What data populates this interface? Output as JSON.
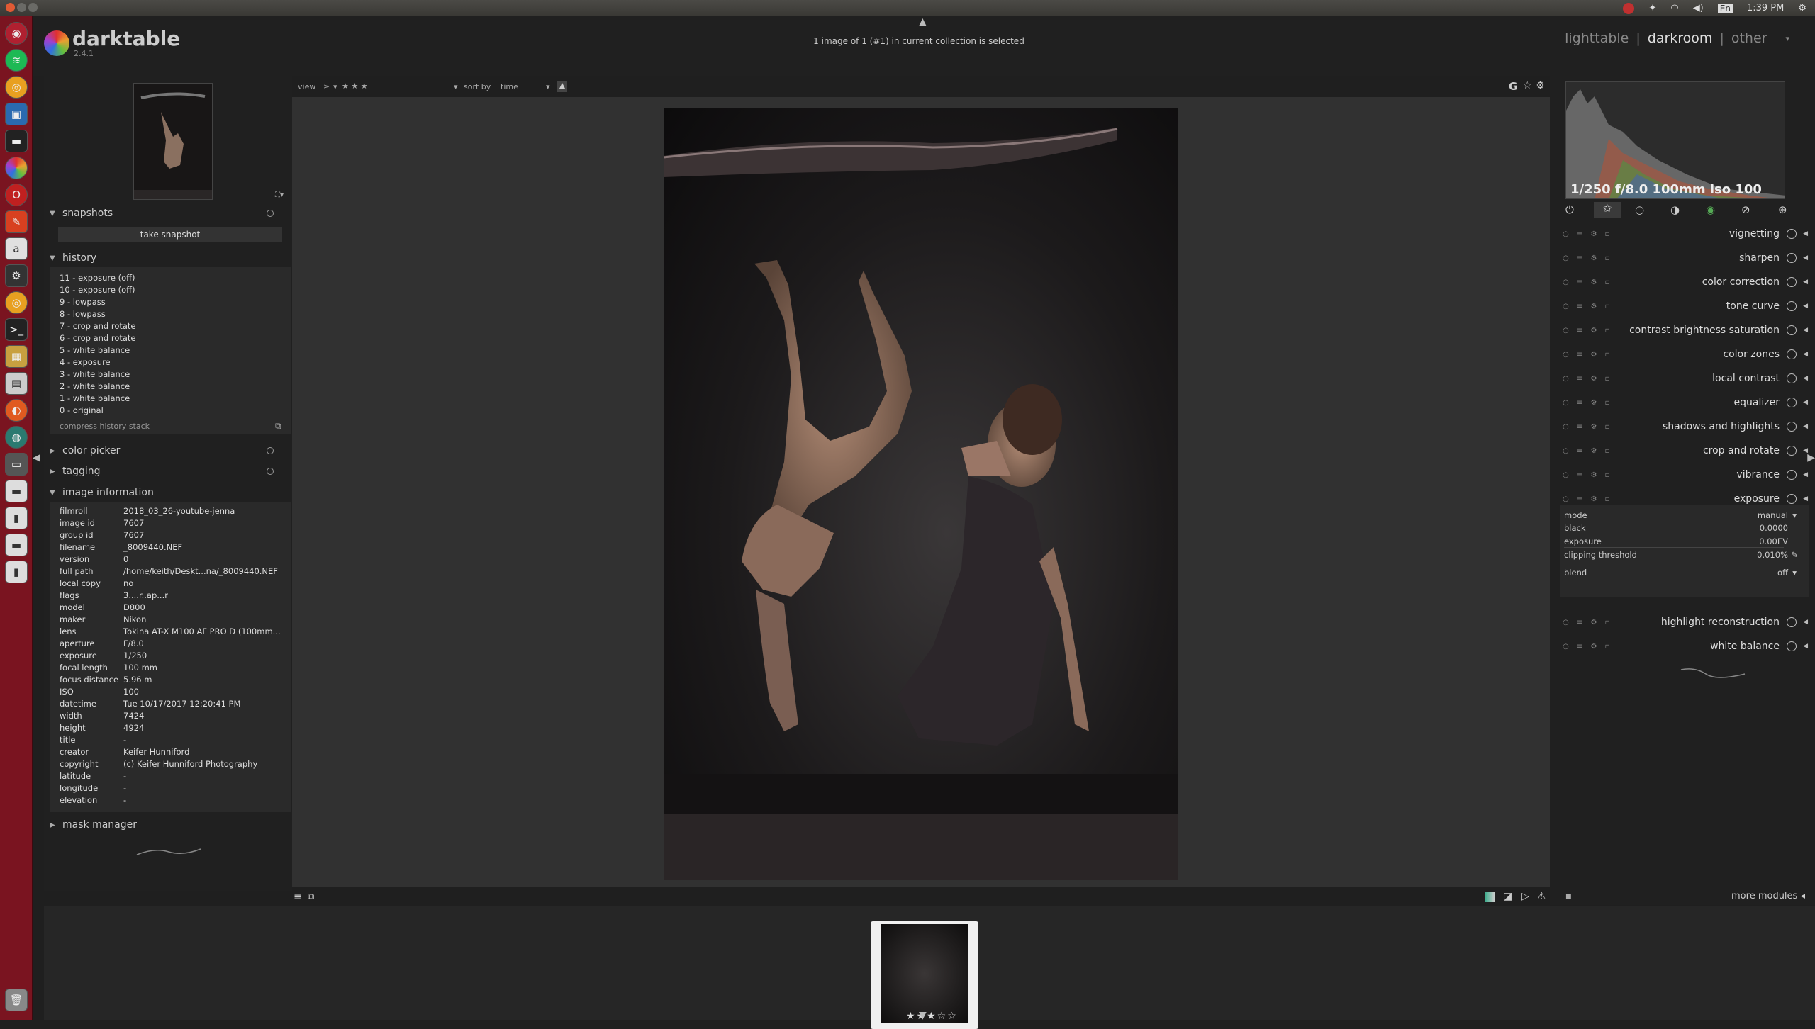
{
  "topbar": {
    "time": "1:39 PM",
    "lang": "En"
  },
  "app": {
    "name": "darktable",
    "version": "2.4.1"
  },
  "header": {
    "collection_info": "1 image of 1 (#1) in current collection is selected"
  },
  "views": {
    "lighttable": "lighttable",
    "darkroom": "darkroom",
    "other": "other",
    "sep": "|"
  },
  "toolbar": {
    "view_label": "view",
    "view_op": "≥",
    "stars": "★ ★ ★",
    "sort_label": "sort by",
    "sort_value": "time",
    "g_label": "G"
  },
  "snapshots": {
    "title": "snapshots",
    "button": "take snapshot"
  },
  "history": {
    "title": "history",
    "items": [
      "11 - exposure (off)",
      "10 - exposure (off)",
      "9 - lowpass",
      "8 - lowpass",
      "7 - crop and rotate",
      "6 - crop and rotate",
      "5 - white balance",
      "4 - exposure",
      "3 - white balance",
      "2 - white balance",
      "1 - white balance",
      "0 - original"
    ],
    "compress": "compress history stack"
  },
  "color_picker": {
    "title": "color picker"
  },
  "tagging": {
    "title": "tagging"
  },
  "image_information": {
    "title": "image information",
    "rows": [
      [
        "filmroll",
        "2018_03_26-youtube-jenna"
      ],
      [
        "image id",
        "7607"
      ],
      [
        "group id",
        "7607"
      ],
      [
        "filename",
        "_8009440.NEF"
      ],
      [
        "version",
        "0"
      ],
      [
        "full path",
        "/home/keith/Deskt...na/_8009440.NEF"
      ],
      [
        "local copy",
        "no"
      ],
      [
        "flags",
        "3....r..ap...r"
      ],
      [
        "model",
        "D800"
      ],
      [
        "maker",
        "Nikon"
      ],
      [
        "lens",
        "Tokina AT-X M100 AF PRO D (100mm..."
      ],
      [
        "aperture",
        "F/8.0"
      ],
      [
        "exposure",
        "1/250"
      ],
      [
        "focal length",
        "100 mm"
      ],
      [
        "focus distance",
        "5.96 m"
      ],
      [
        "ISO",
        "100"
      ],
      [
        "datetime",
        "Tue 10/17/2017 12:20:41 PM"
      ],
      [
        "width",
        "7424"
      ],
      [
        "height",
        "4924"
      ],
      [
        "title",
        "-"
      ],
      [
        "creator",
        "Keifer Hunniford"
      ],
      [
        "copyright",
        "(c) Keifer Hunniford Photography"
      ],
      [
        "latitude",
        "-"
      ],
      [
        "longitude",
        "-"
      ],
      [
        "elevation",
        "-"
      ]
    ]
  },
  "mask_manager": {
    "title": "mask manager"
  },
  "histogram": {
    "exif": "1/250 f/8.0 100mm iso 100"
  },
  "modules": [
    {
      "name": "vignetting"
    },
    {
      "name": "sharpen"
    },
    {
      "name": "color correction"
    },
    {
      "name": "tone curve"
    },
    {
      "name": "contrast brightness saturation"
    },
    {
      "name": "color zones"
    },
    {
      "name": "local contrast"
    },
    {
      "name": "equalizer"
    },
    {
      "name": "shadows and highlights"
    },
    {
      "name": "crop and rotate"
    },
    {
      "name": "vibrance"
    },
    {
      "name": "exposure"
    }
  ],
  "exposure_params": {
    "mode": {
      "label": "mode",
      "value": "manual"
    },
    "black": {
      "label": "black",
      "value": "0.0000"
    },
    "exposure": {
      "label": "exposure",
      "value": "0.00EV"
    },
    "clipping": {
      "label": "clipping threshold",
      "value": "0.010%"
    },
    "blend": {
      "label": "blend",
      "value": "off"
    }
  },
  "modules_after": [
    {
      "name": "highlight reconstruction"
    },
    {
      "name": "white balance"
    }
  ],
  "more_modules": "more modules",
  "filmstrip": {
    "stars": "★★★☆☆"
  },
  "colors": {
    "launcher": "#7a1420",
    "panel": "#202020",
    "center": "#313131",
    "accent_close": "#e15a34"
  }
}
